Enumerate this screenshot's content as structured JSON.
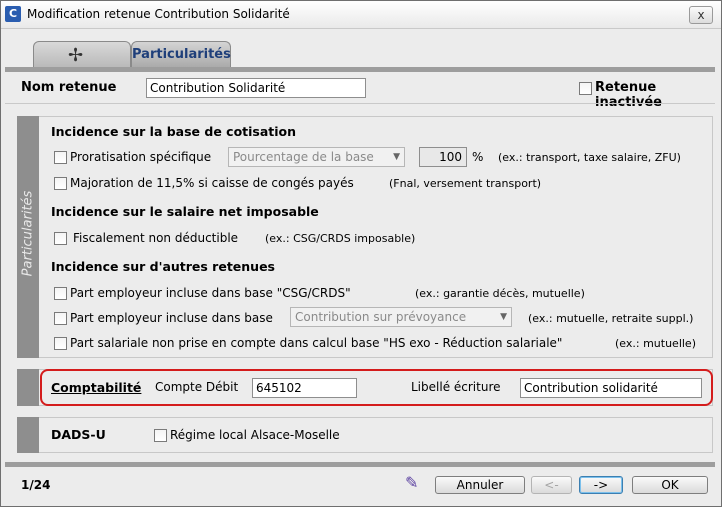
{
  "window": {
    "title": "Modification retenue Contribution Solidarité",
    "close_label": "x",
    "app_icon_letter": "C"
  },
  "tabs": [
    {
      "label": "",
      "icon": "pinwheel-icon",
      "glyph": "✢"
    },
    {
      "label": "Particularités",
      "active": true
    }
  ],
  "header": {
    "nom_label": "Nom retenue",
    "nom_value": "Contribution Solidarité",
    "inactive_label": "Retenue inactivée"
  },
  "side_label": "Particularités",
  "base_cotisation": {
    "heading": "Incidence sur la base de cotisation",
    "proratisation_label": "Proratisation spécifique",
    "proratisation_select": "Pourcentage de la base",
    "percent_value": "100",
    "percent_unit": "%",
    "proratisation_hint": "(ex.: transport, taxe salaire, ZFU)",
    "majoration_label": "Majoration de 11,5% si caisse de congés payés",
    "majoration_hint": "(Fnal, versement transport)"
  },
  "net_imposable": {
    "heading": "Incidence sur le salaire net imposable",
    "fiscal_label": "Fiscalement non déductible",
    "fiscal_hint": "(ex.: CSG/CRDS imposable)"
  },
  "autres_retenues": {
    "heading": "Incidence sur d'autres retenues",
    "items": [
      {
        "label": "Part employeur incluse dans base \"CSG/CRDS\"",
        "hint": "(ex.: garantie décès, mutuelle)"
      },
      {
        "label": "Part employeur incluse dans base",
        "select": "Contribution sur prévoyance",
        "hint": "(ex.: mutuelle, retraite suppl.)"
      },
      {
        "label": "Part salariale non prise en compte dans calcul base \"HS exo - Réduction salariale\"",
        "hint": "(ex.: mutuelle)"
      }
    ]
  },
  "comptabilite": {
    "heading": "Comptabilité",
    "compte_label": "Compte Débit",
    "compte_value": "645102",
    "libelle_label": "Libellé écriture",
    "libelle_value": "Contribution solidarité"
  },
  "dads": {
    "heading": "DADS-U",
    "regime_label": "Régime local Alsace-Moselle"
  },
  "footer": {
    "pager": "1/24",
    "annuler_label": "Annuler",
    "prev_label": "<-",
    "next_label": "->",
    "ok_label": "OK"
  },
  "colors": {
    "highlight": "#d41c1c",
    "tab_text": "#1f3f7a",
    "strip": "#8e8e8e"
  }
}
